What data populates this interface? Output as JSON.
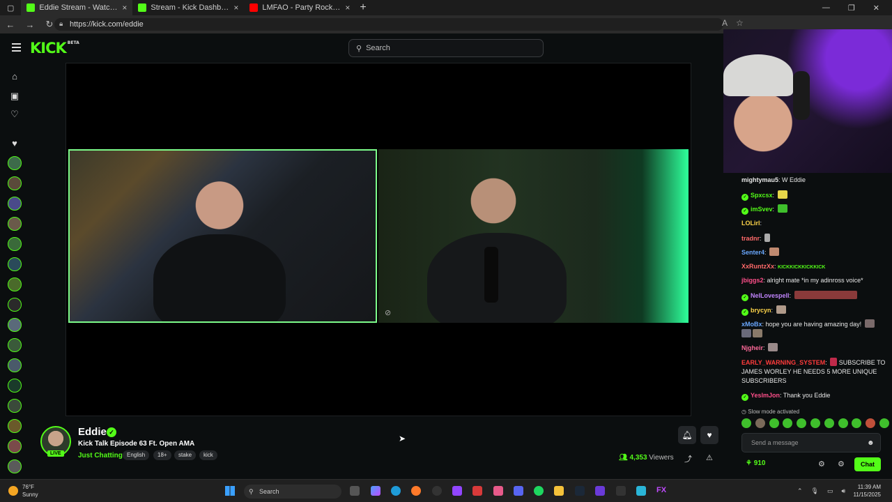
{
  "browser": {
    "tabs": [
      {
        "title": "Eddie Stream - Watch Live on Kick",
        "favicon_color": "#53fc18",
        "active": true
      },
      {
        "title": "Stream - Kick Dashboard",
        "favicon_color": "#53fc18",
        "active": false
      },
      {
        "title": "LMFAO - Party Rock Anthem ft. Lauren Bennett",
        "favicon_color": "#ff0000",
        "active": false
      }
    ],
    "new_tab_label": "+",
    "url": "https://kick.com/eddie"
  },
  "header": {
    "logo": "KICK",
    "logo_badge": "BETA",
    "search_placeholder": "Search"
  },
  "stream": {
    "streamer": "Eddie",
    "live_label": "LIVE",
    "title": "Kick Talk Episode 63 Ft. Open AMA",
    "category": "Just Chatting",
    "tags": [
      "English",
      "18+",
      "stake",
      "kick"
    ],
    "viewer_count": "4,353",
    "viewer_label": "Viewers"
  },
  "chat": {
    "messages": [
      {
        "user": "mightymau5",
        "color": "#e8e8e8",
        "verified": false,
        "text": "W Eddie"
      },
      {
        "user": "Spxcsx",
        "color": "#53fc18",
        "verified": true,
        "text": ""
      },
      {
        "user": "imSvev",
        "color": "#53fc18",
        "verified": true,
        "text": ""
      },
      {
        "user": "LOLirl",
        "color": "#ffd54a",
        "verified": false,
        "text": ""
      },
      {
        "user": "tradnr",
        "color": "#ff6a6a",
        "verified": false,
        "text": ""
      },
      {
        "user": "Senter4",
        "color": "#6aa8ff",
        "verified": false,
        "text": ""
      },
      {
        "user": "XxRuntzXx",
        "color": "#ff6a6a",
        "verified": false,
        "text": "KICKKICKKICKKICK"
      },
      {
        "user": "jbiggs2",
        "color": "#ff4f8a",
        "verified": false,
        "text": "alright mate *in my adinross voice*"
      },
      {
        "user": "NelLovespell",
        "color": "#c084fc",
        "verified": true,
        "text": ""
      },
      {
        "user": "brycyn",
        "color": "#ffd54a",
        "verified": true,
        "text": ""
      },
      {
        "user": "xMoBx",
        "color": "#6aa8ff",
        "verified": false,
        "text": "hope you are having amazing day!"
      },
      {
        "user": "Njgheir",
        "color": "#ff6a9a",
        "verified": false,
        "text": ""
      },
      {
        "user": "EARLY_WARNING_SYSTEM",
        "color": "#ff3b3b",
        "verified": false,
        "text": "SUBSCRIBE TO JAMES WORLEY HE NEEDS 5 MORE UNIQUE SUBSCRIBERS"
      },
      {
        "user": "YeslmJon",
        "color": "#ff4f8a",
        "verified": true,
        "text": "Thank you Eddie"
      }
    ],
    "slow_mode": "Slow mode activated",
    "input_placeholder": "Send a message",
    "points": "910",
    "send_label": "Chat"
  },
  "taskbar": {
    "temperature": "76°F",
    "weather": "Sunny",
    "search_label": "Search",
    "time": "11:39 AM",
    "date": "11/15/2025"
  }
}
